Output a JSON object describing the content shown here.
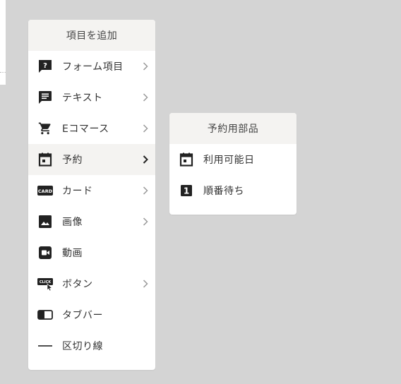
{
  "main_menu": {
    "title": "項目を追加",
    "items": [
      {
        "label": "フォーム項目",
        "icon": "form-question-icon",
        "has_submenu": true
      },
      {
        "label": "テキスト",
        "icon": "chat-text-icon",
        "has_submenu": true
      },
      {
        "label": "Eコマース",
        "icon": "shopping-cart-icon",
        "has_submenu": true
      },
      {
        "label": "予約",
        "icon": "calendar-icon",
        "has_submenu": true,
        "active": true
      },
      {
        "label": "カード",
        "icon": "card-icon",
        "has_submenu": true
      },
      {
        "label": "画像",
        "icon": "image-icon",
        "has_submenu": true
      },
      {
        "label": "動画",
        "icon": "video-icon",
        "has_submenu": false
      },
      {
        "label": "ボタン",
        "icon": "click-button-icon",
        "has_submenu": true
      },
      {
        "label": "タブバー",
        "icon": "tab-bar-icon",
        "has_submenu": false
      },
      {
        "label": "区切り線",
        "icon": "divider-line-icon",
        "has_submenu": false
      }
    ]
  },
  "sub_menu": {
    "title": "予約用部品",
    "items": [
      {
        "label": "利用可能日",
        "icon": "calendar-icon"
      },
      {
        "label": "順番待ち",
        "icon": "number-one-icon"
      }
    ]
  },
  "colors": {
    "background": "#d4d4d4",
    "panel": "#ffffff",
    "header": "#f4f3f1",
    "icon": "#222222",
    "chevron_inactive": "#999999",
    "chevron_active": "#222222"
  }
}
